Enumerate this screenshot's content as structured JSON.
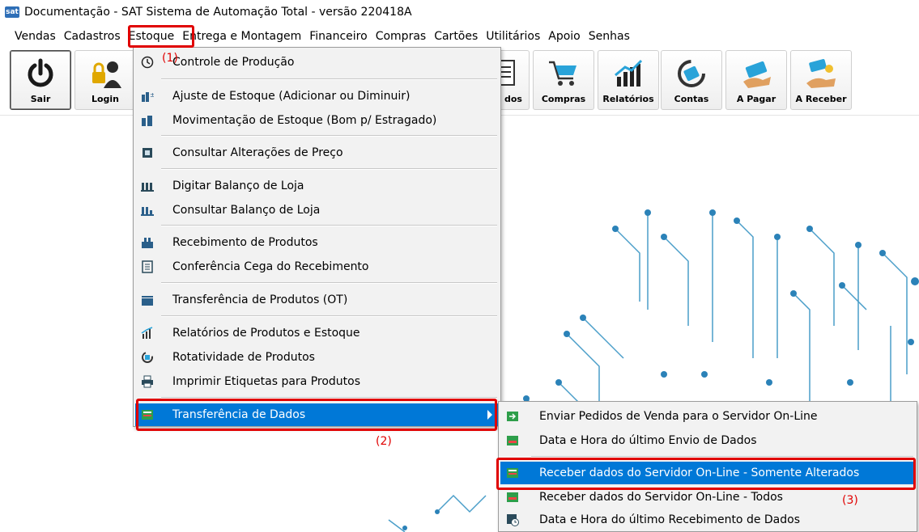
{
  "window": {
    "title": "Documentação - SAT Sistema de Automação Total - versão 220418A",
    "icon": "sat-app-icon",
    "icon_text": "sat"
  },
  "menubar": [
    "Vendas",
    "Cadastros",
    "Estoque",
    "Entrega e Montagem",
    "Financeiro",
    "Compras",
    "Cartões",
    "Utilitários",
    "Apoio",
    "Senhas"
  ],
  "toolbar": {
    "sair": "Sair",
    "login": "Login",
    "pedidos_partial": "dos",
    "compras": "Compras",
    "relatorios": "Relatórios",
    "contas": "Contas",
    "apagar": "A Pagar",
    "areceber": "A Receber"
  },
  "estoque_menu": [
    {
      "label": "Controle de Produção",
      "icon": "clock-icon"
    },
    {
      "label": "Ajuste de Estoque  (Adicionar ou Diminuir)",
      "icon": "stock-adjust-icon"
    },
    {
      "label": "Movimentação de Estoque (Bom p/ Estragado)",
      "icon": "stock-move-icon"
    },
    {
      "label": "Consultar Alterações de Preço",
      "icon": "price-icon"
    },
    {
      "label": "Digitar Balanço de Loja",
      "icon": "balance-icon"
    },
    {
      "label": "Consultar Balanço de Loja",
      "icon": "balance-query-icon"
    },
    {
      "label": "Recebimento de Produtos",
      "icon": "receive-icon"
    },
    {
      "label": "Conferência Cega do Recebimento",
      "icon": "checklist-icon"
    },
    {
      "label": "Transferência de Produtos (OT)",
      "icon": "transfer-icon"
    },
    {
      "label": "Relatórios de Produtos e Estoque",
      "icon": "report-icon"
    },
    {
      "label": "Rotatividade de Produtos",
      "icon": "rotation-icon"
    },
    {
      "label": "Imprimir Etiquetas para Produtos",
      "icon": "printer-icon"
    },
    {
      "label": "Transferência de Dados",
      "icon": "data-transfer-icon"
    }
  ],
  "submenu": [
    {
      "label": "Enviar Pedidos de Venda para o Servidor On-Line",
      "icon": "send-icon"
    },
    {
      "label": "Data e Hora do último Envio de Dados",
      "icon": "send-time-icon"
    },
    {
      "label": "Receber dados do Servidor On-Line - Somente Alterados",
      "icon": "receive-changed-icon"
    },
    {
      "label": "Receber dados do Servidor On-Line - Todos",
      "icon": "receive-all-icon"
    },
    {
      "label": "Data e Hora do último Recebimento de Dados",
      "icon": "receive-time-icon"
    }
  ],
  "annotations": {
    "a1": "(1)",
    "a2": "(2)",
    "a3": "(3)"
  },
  "colors": {
    "highlight": "#0078d7",
    "annotation": "#e00000"
  }
}
